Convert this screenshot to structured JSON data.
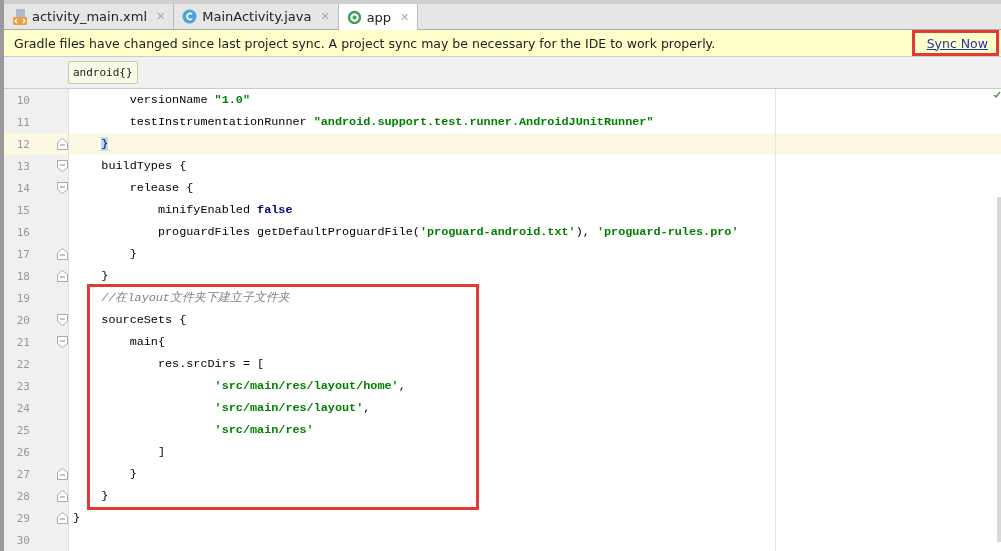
{
  "tabs": [
    {
      "label": "activity_main.xml",
      "close": "✕",
      "selected": false
    },
    {
      "label": "MainActivity.java",
      "close": "✕",
      "selected": false
    },
    {
      "label": "app",
      "close": "✕",
      "selected": true
    }
  ],
  "banner": {
    "message": "Gradle files have changed since last project sync. A project sync may be necessary for the IDE to work properly.",
    "link": "Sync Now",
    "outlined": true
  },
  "breadcrumb": "android{}",
  "editor": {
    "lines": [
      {
        "number": "10",
        "fold_start": false,
        "fold_end": false,
        "current": false,
        "boxed": false,
        "tokens": [
          {
            "kind": "plain",
            "text": "        versionName "
          },
          {
            "kind": "string",
            "text": "\"1.0\""
          }
        ]
      },
      {
        "number": "11",
        "fold_start": false,
        "fold_end": false,
        "current": false,
        "boxed": false,
        "tokens": [
          {
            "kind": "plain",
            "text": "        testInstrumentationRunner "
          },
          {
            "kind": "string",
            "text": "\"android.support.test.runner.AndroidJUnitRunner\""
          }
        ]
      },
      {
        "number": "12",
        "fold_start": false,
        "fold_end": true,
        "current": true,
        "boxed": false,
        "tokens": [
          {
            "kind": "plain",
            "text": "    }",
            "matched": true
          }
        ]
      },
      {
        "number": "13",
        "fold_start": true,
        "fold_end": false,
        "current": false,
        "boxed": false,
        "tokens": [
          {
            "kind": "plain",
            "text": "    buildTypes {"
          }
        ]
      },
      {
        "number": "14",
        "fold_start": true,
        "fold_end": false,
        "current": false,
        "boxed": false,
        "tokens": [
          {
            "kind": "plain",
            "text": "        release {"
          }
        ]
      },
      {
        "number": "15",
        "fold_start": false,
        "fold_end": false,
        "current": false,
        "boxed": false,
        "tokens": [
          {
            "kind": "plain",
            "text": "            minifyEnabled "
          },
          {
            "kind": "keyword",
            "text": "false"
          }
        ]
      },
      {
        "number": "16",
        "fold_start": false,
        "fold_end": false,
        "current": false,
        "boxed": false,
        "tokens": [
          {
            "kind": "plain",
            "text": "            proguardFiles getDefaultProguardFile("
          },
          {
            "kind": "string",
            "text": "'proguard-android.txt'"
          },
          {
            "kind": "plain",
            "text": "), "
          },
          {
            "kind": "string",
            "text": "'proguard-rules.pro'"
          }
        ]
      },
      {
        "number": "17",
        "fold_start": false,
        "fold_end": true,
        "current": false,
        "boxed": false,
        "tokens": [
          {
            "kind": "plain",
            "text": "        }"
          }
        ]
      },
      {
        "number": "18",
        "fold_start": false,
        "fold_end": true,
        "current": false,
        "boxed": false,
        "tokens": [
          {
            "kind": "plain",
            "text": "    }"
          }
        ]
      },
      {
        "number": "19",
        "fold_start": false,
        "fold_end": false,
        "current": false,
        "boxed": true,
        "tokens": [
          {
            "kind": "comment",
            "text": "    //在layout文件夹下建立子文件夹"
          }
        ]
      },
      {
        "number": "20",
        "fold_start": true,
        "fold_end": false,
        "current": false,
        "boxed": true,
        "tokens": [
          {
            "kind": "plain",
            "text": "    sourceSets {"
          }
        ]
      },
      {
        "number": "21",
        "fold_start": true,
        "fold_end": false,
        "current": false,
        "boxed": true,
        "tokens": [
          {
            "kind": "plain",
            "text": "        main{"
          }
        ]
      },
      {
        "number": "22",
        "fold_start": false,
        "fold_end": false,
        "current": false,
        "boxed": true,
        "tokens": [
          {
            "kind": "plain",
            "text": "            res.srcDirs = ["
          }
        ]
      },
      {
        "number": "23",
        "fold_start": false,
        "fold_end": false,
        "current": false,
        "boxed": true,
        "tokens": [
          {
            "kind": "string",
            "text": "                    'src/main/res/layout/home'"
          },
          {
            "kind": "plain",
            "text": ","
          }
        ]
      },
      {
        "number": "24",
        "fold_start": false,
        "fold_end": false,
        "current": false,
        "boxed": true,
        "tokens": [
          {
            "kind": "string",
            "text": "                    'src/main/res/layout'"
          },
          {
            "kind": "plain",
            "text": ","
          }
        ]
      },
      {
        "number": "25",
        "fold_start": false,
        "fold_end": false,
        "current": false,
        "boxed": true,
        "tokens": [
          {
            "kind": "string",
            "text": "                    'src/main/res'"
          }
        ]
      },
      {
        "number": "26",
        "fold_start": false,
        "fold_end": false,
        "current": false,
        "boxed": true,
        "tokens": [
          {
            "kind": "plain",
            "text": "            ]"
          }
        ]
      },
      {
        "number": "27",
        "fold_start": false,
        "fold_end": true,
        "current": false,
        "boxed": true,
        "tokens": [
          {
            "kind": "plain",
            "text": "        }"
          }
        ]
      },
      {
        "number": "28",
        "fold_start": false,
        "fold_end": true,
        "current": false,
        "boxed": true,
        "tokens": [
          {
            "kind": "plain",
            "text": "    }"
          }
        ]
      },
      {
        "number": "29",
        "fold_start": false,
        "fold_end": true,
        "current": false,
        "boxed": false,
        "tokens": [
          {
            "kind": "plain",
            "text": "}"
          }
        ]
      },
      {
        "number": "30",
        "fold_start": false,
        "fold_end": false,
        "current": false,
        "boxed": false
      }
    ]
  }
}
